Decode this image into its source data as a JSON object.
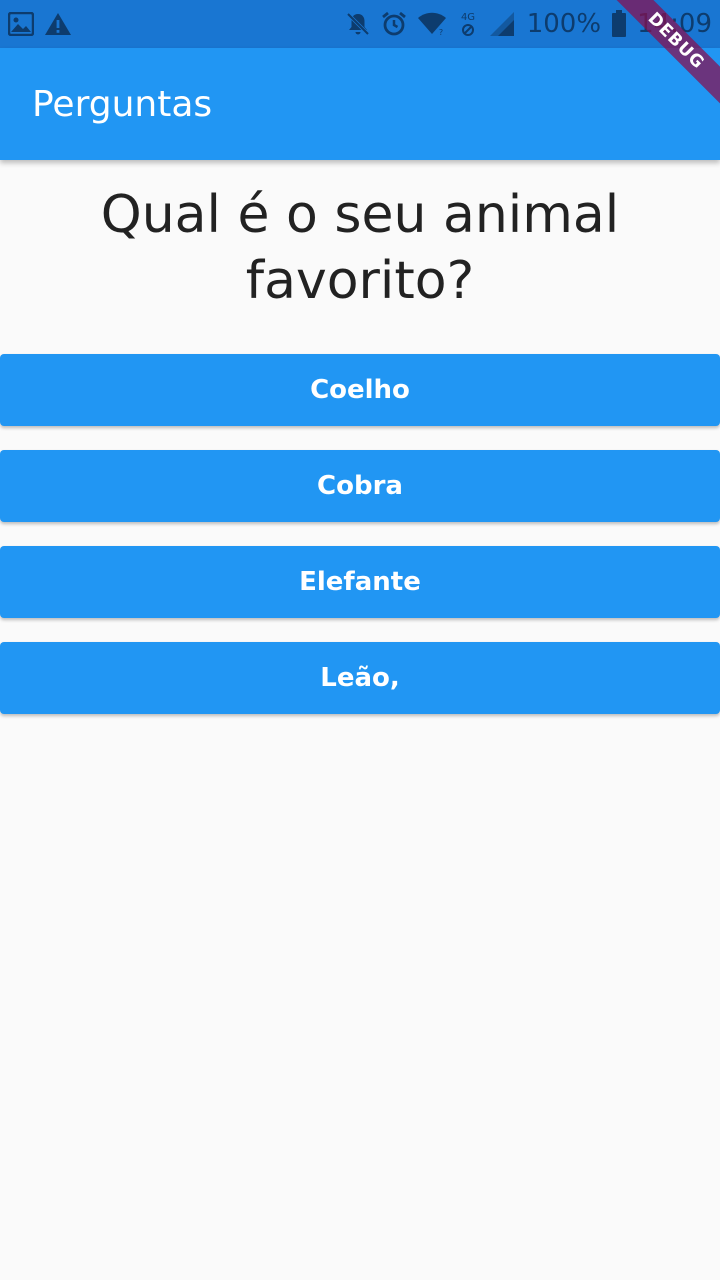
{
  "status_bar": {
    "battery_percent": "100%",
    "time": "14:09",
    "network_label": "4G",
    "icons": [
      "image-icon",
      "warning-icon",
      "mute-icon",
      "alarm-icon",
      "wifi-icon",
      "mobile-data-icon",
      "signal-icon",
      "battery-icon"
    ]
  },
  "app_bar": {
    "title": "Perguntas",
    "color": "#2196f3"
  },
  "debug_banner": {
    "label": "DEBUG"
  },
  "question": {
    "text": "Qual é o seu animal favorito?"
  },
  "answers": [
    {
      "label": "Coelho"
    },
    {
      "label": "Cobra"
    },
    {
      "label": "Elefante"
    },
    {
      "label": "Leão,"
    }
  ],
  "colors": {
    "primary": "#2196f3",
    "status_bar": "#1976d2",
    "background": "#fafafa",
    "text": "#222222"
  }
}
